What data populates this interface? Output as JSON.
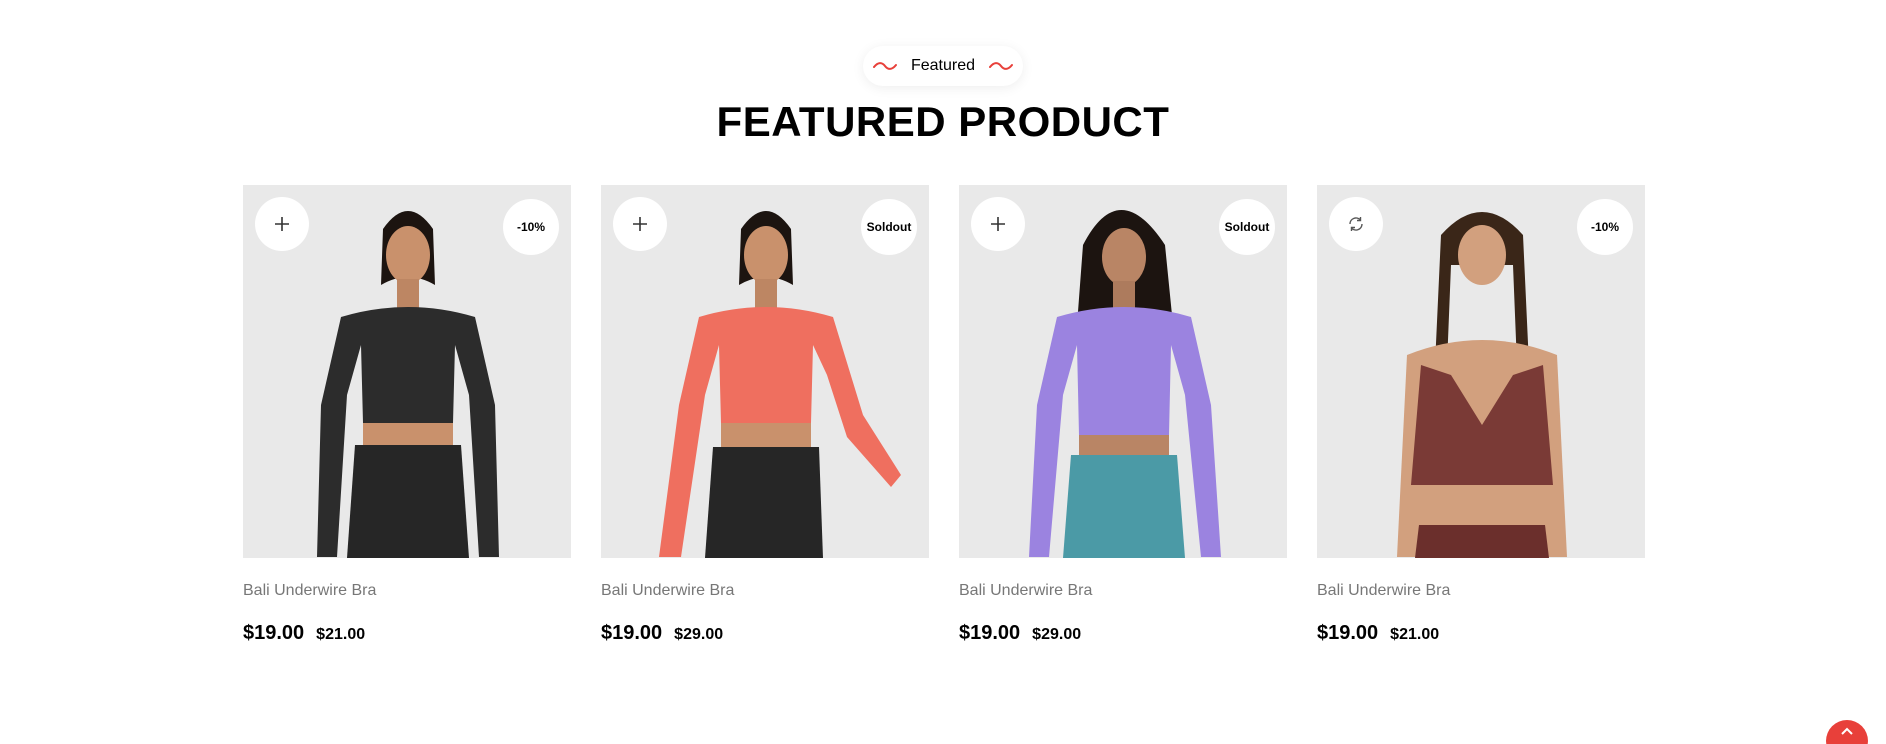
{
  "section": {
    "eyebrow": "Featured",
    "title": "FEATURED PRODUCT",
    "accent_color": "#e8403a"
  },
  "products": [
    {
      "name": "Bali Underwire Bra",
      "price": "$19.00",
      "old_price": "$21.00",
      "badge": "-10%",
      "action_icon": "plus-icon",
      "top_color": "#2c2c2c",
      "bottom_color": "#262626"
    },
    {
      "name": "Bali Underwire Bra",
      "price": "$19.00",
      "old_price": "$29.00",
      "badge": "Soldout",
      "action_icon": "plus-icon",
      "top_color": "#ef6f5f",
      "bottom_color": "#262626"
    },
    {
      "name": "Bali Underwire Bra",
      "price": "$19.00",
      "old_price": "$29.00",
      "badge": "Soldout",
      "action_icon": "plus-icon",
      "top_color": "#9b83e0",
      "bottom_color": "#4b9aa6"
    },
    {
      "name": "Bali Underwire Bra",
      "price": "$19.00",
      "old_price": "$21.00",
      "badge": "-10%",
      "action_icon": "refresh-icon",
      "top_color": "#7a3a36",
      "bottom_color": "#6b2f2c"
    }
  ],
  "scroll_top": {
    "icon": "chevron-up-icon"
  }
}
